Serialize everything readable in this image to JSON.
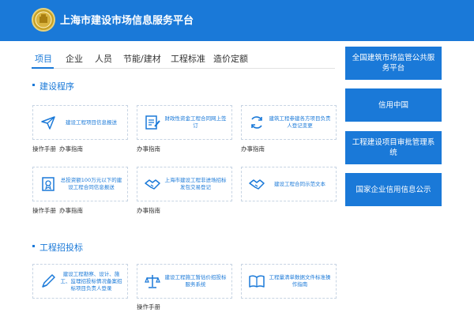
{
  "header": {
    "title": "上海市建设市场信息服务平台"
  },
  "tabs": [
    {
      "label": "项目",
      "active": true
    },
    {
      "label": "企业"
    },
    {
      "label": "人员"
    },
    {
      "label": "节能/建材"
    },
    {
      "label": "工程标准"
    },
    {
      "label": "造价定额"
    }
  ],
  "sections": [
    {
      "title": "建设程序",
      "cards": [
        {
          "label": "建设工程项目信息报送",
          "icon": "send-icon",
          "links": [
            "操作手册",
            "办事指南"
          ]
        },
        {
          "label": "财政性资金工程合同网上签订",
          "icon": "edit-document-icon",
          "links": [
            "办事指南"
          ]
        },
        {
          "label": "建筑工程参建各方项目负责人登记变更",
          "icon": "refresh-icon",
          "links": [
            "办事指南"
          ]
        },
        {
          "label": "总投资额100万元以下的建设工程合同信息报送",
          "icon": "document-seal-icon",
          "links": [
            "操作手册",
            "办事指南"
          ]
        },
        {
          "label": "上海市建设工程非进场招标发包交易登记",
          "icon": "handshake-icon",
          "links": [
            "办事指南"
          ]
        },
        {
          "label": "建设工程合同示范文本",
          "icon": "handshake-icon",
          "links": []
        }
      ]
    },
    {
      "title": "工程招投标",
      "cards": [
        {
          "label": "建设工程勘察、设计、施工、监理招投标情况备案招标项目负责人登录",
          "icon": "pen-icon",
          "links": []
        },
        {
          "label": "建设工程施工暂估价招投标服务系统",
          "icon": "scales-icon",
          "links": [
            "操作手册"
          ]
        },
        {
          "label": "工程量清单数据文件标准操作指南",
          "icon": "book-icon",
          "links": []
        }
      ]
    }
  ],
  "sidebar": [
    {
      "label": "全国建筑市场监管公共服务平台"
    },
    {
      "label": "信用中国"
    },
    {
      "label": "工程建设项目审批管理系统"
    },
    {
      "label": "国家企业信用信息公示"
    }
  ]
}
